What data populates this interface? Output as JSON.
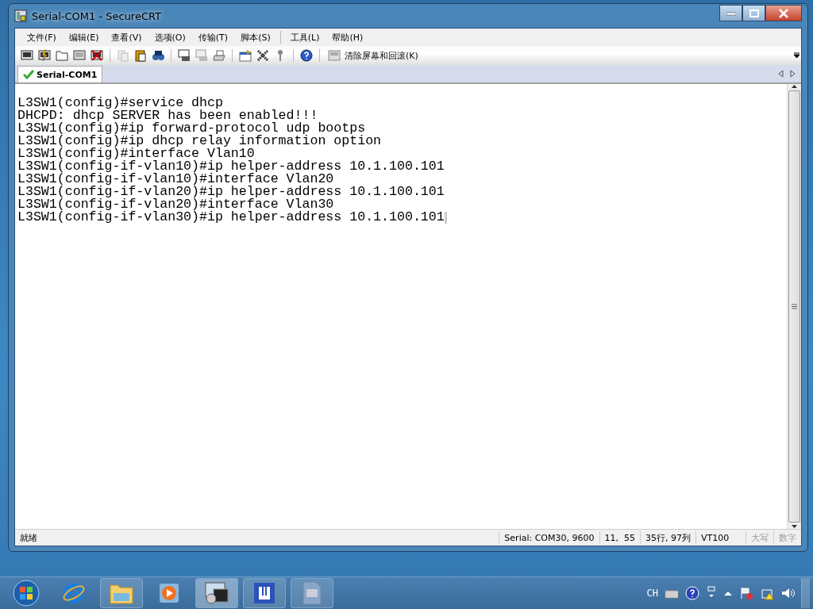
{
  "window": {
    "title": "Serial-COM1 - SecureCRT"
  },
  "menu": [
    "文件(F)",
    "编辑(E)",
    "查看(V)",
    "选项(O)",
    "传输(T)",
    "脚本(S)",
    "工具(L)",
    "帮助(H)"
  ],
  "toolbar": {
    "clear_button": "清除屏幕和回滚(K)"
  },
  "tabs": [
    {
      "label": "Serial-COM1",
      "selected": true
    }
  ],
  "terminal": {
    "lines": [
      "L3SW1(config)#service dhcp",
      "DHCPD: dhcp SERVER has been enabled!!!",
      "L3SW1(config)#ip forward-protocol udp bootps",
      "L3SW1(config)#ip dhcp relay information option",
      "L3SW1(config)#interface Vlan10",
      "L3SW1(config-if-vlan10)#ip helper-address 10.1.100.101",
      "L3SW1(config-if-vlan10)#interface Vlan20",
      "L3SW1(config-if-vlan20)#ip helper-address 10.1.100.101",
      "L3SW1(config-if-vlan20)#interface Vlan30",
      "L3SW1(config-if-vlan30)#ip helper-address 10.1.100.101"
    ]
  },
  "status_bar": {
    "message": "就绪",
    "connection": "Serial: COM30, 9600",
    "cursor": "11,  55",
    "size": "35行, 97列",
    "emulation": "VT100",
    "indicators": [
      {
        "label": "大写",
        "active": false
      },
      {
        "label": "数字",
        "active": false
      }
    ]
  },
  "taskbar": {
    "tray": {
      "language": "CH"
    }
  }
}
